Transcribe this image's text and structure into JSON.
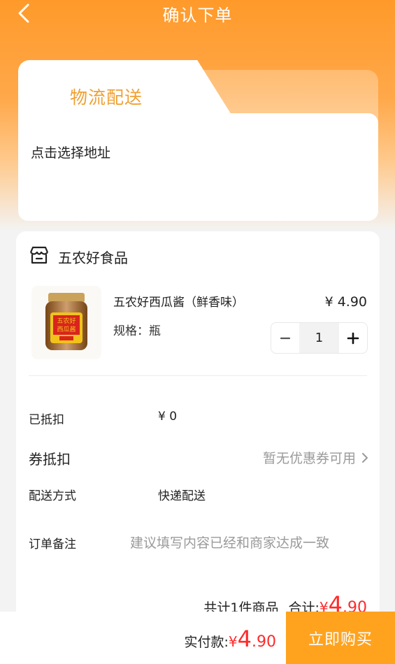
{
  "header": {
    "title": "确认下单",
    "back_icon": "chevron-left-icon"
  },
  "delivery": {
    "active_tab": "物流配送",
    "address_placeholder": "点击选择地址"
  },
  "shop": {
    "name": "五农好食品",
    "icon": "store-icon"
  },
  "product": {
    "name": "五农好西瓜酱（鲜香味）",
    "spec": "规格：瓶",
    "price": "¥ 4.90",
    "quantity": "1",
    "jar_label": "五农好\n西瓜酱"
  },
  "rows": {
    "deducted_label": "已抵扣",
    "deducted_value": "¥ 0",
    "coupon_label": "券抵扣",
    "coupon_value": "暂无优惠券可用",
    "shipping_label": "配送方式",
    "shipping_value": "快递配送",
    "remark_label": "订单备注",
    "remark_placeholder": "建议填写内容已经和商家达成一致"
  },
  "summary": {
    "count_text": "共计1件商品",
    "total_label": "合计:",
    "symbol": "¥",
    "int": "4",
    "dec": ".90"
  },
  "bottom": {
    "pay_label": "实付款:",
    "symbol": "¥",
    "int": "4",
    "dec": ".90",
    "buy_label": "立即购买"
  },
  "colors": {
    "orange": "#ff9a2a",
    "tab_text": "#f0a032",
    "price_red": "#ff2a2a",
    "buy_button": "#ffa31f"
  }
}
